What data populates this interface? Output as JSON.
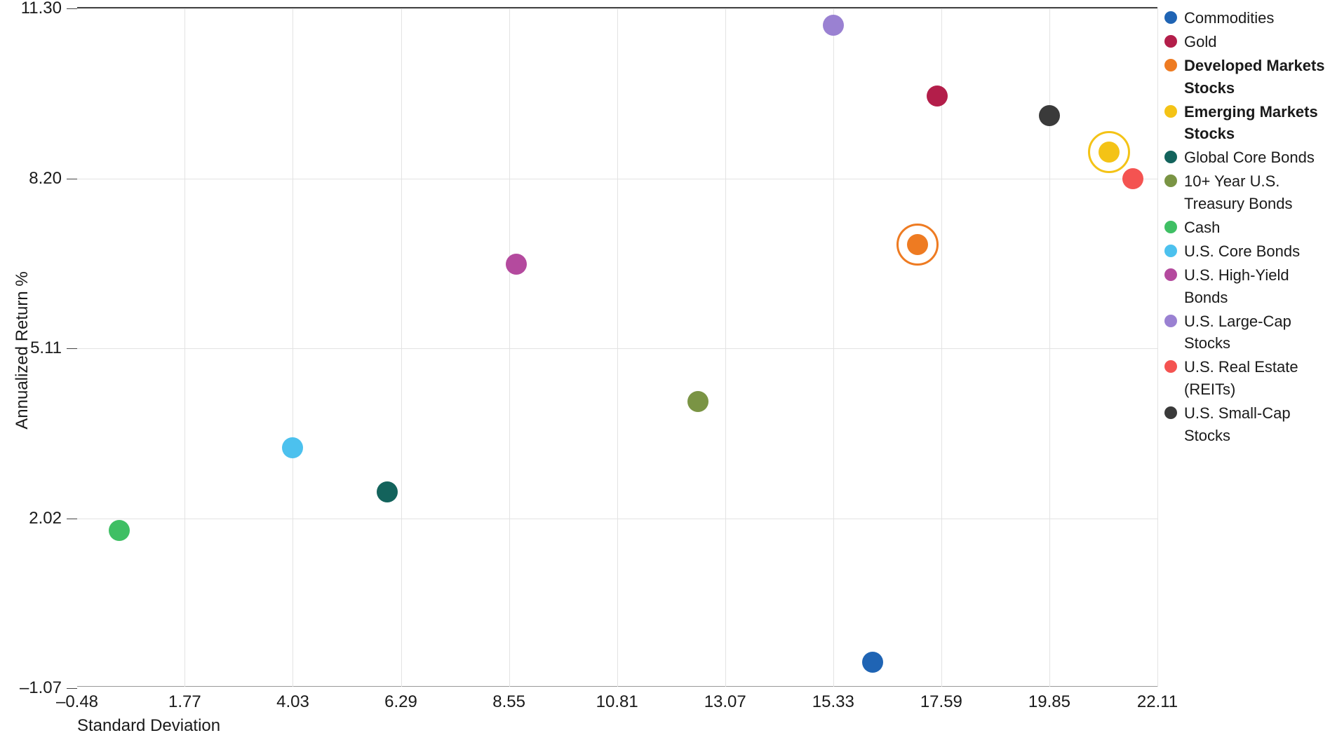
{
  "chart_data": {
    "type": "scatter",
    "xlabel": "Standard Deviation",
    "ylabel": "Annualized Return %",
    "x_ticks": [
      -0.48,
      1.77,
      4.03,
      6.29,
      8.55,
      10.81,
      13.07,
      15.33,
      17.59,
      19.85,
      22.11
    ],
    "y_ticks": [
      -1.07,
      2.02,
      5.11,
      8.2,
      11.3
    ],
    "xlim": [
      -0.48,
      22.11
    ],
    "ylim": [
      -1.07,
      11.3
    ],
    "series": [
      {
        "name": "Commodities",
        "x": 16.15,
        "y": -0.6,
        "color": "#1f64b4",
        "highlighted": false
      },
      {
        "name": "Gold",
        "x": 17.5,
        "y": 9.7,
        "color": "#b31e4a",
        "highlighted": false
      },
      {
        "name": "Developed Markets Stocks",
        "x": 17.1,
        "y": 7.0,
        "color": "#ee7b22",
        "highlighted": true
      },
      {
        "name": "Emerging Markets Stocks",
        "x": 21.1,
        "y": 8.68,
        "color": "#f4c316",
        "highlighted": true
      },
      {
        "name": "Global Core Bonds",
        "x": 6.0,
        "y": 2.5,
        "color": "#13635c",
        "highlighted": false
      },
      {
        "name": "10+ Year U.S. Treasury Bonds",
        "x": 12.5,
        "y": 4.15,
        "color": "#7a9444",
        "highlighted": false
      },
      {
        "name": "Cash",
        "x": 0.4,
        "y": 1.8,
        "color": "#3fbf64",
        "highlighted": false
      },
      {
        "name": "U.S. Core Bonds",
        "x": 4.03,
        "y": 3.3,
        "color": "#4cc1ee",
        "highlighted": false
      },
      {
        "name": "U.S. High-Yield Bonds",
        "x": 8.7,
        "y": 6.65,
        "color": "#b44a9e",
        "highlighted": false
      },
      {
        "name": "U.S. Large-Cap Stocks",
        "x": 15.33,
        "y": 11.0,
        "color": "#9a81d2",
        "highlighted": false
      },
      {
        "name": "U.S. Real Estate (REITs)",
        "x": 21.6,
        "y": 8.2,
        "color": "#f45351",
        "highlighted": false
      },
      {
        "name": "U.S. Small-Cap Stocks",
        "x": 19.85,
        "y": 9.35,
        "color": "#3a3a3a",
        "highlighted": false
      }
    ]
  }
}
